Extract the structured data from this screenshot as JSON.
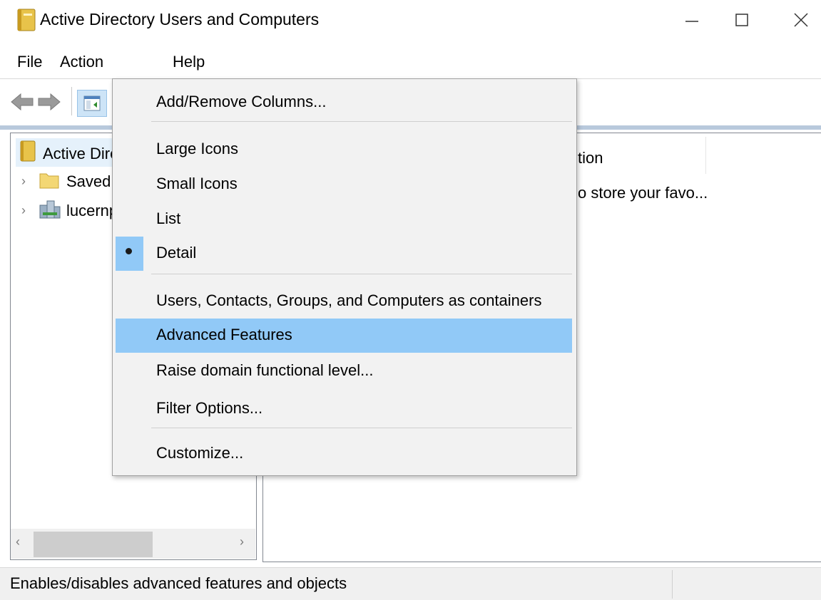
{
  "window": {
    "title": "Active Directory Users and Computers",
    "minimize_icon": "minimize-icon",
    "maximize_icon": "maximize-icon",
    "close_icon": "close-icon"
  },
  "menubar": {
    "file": "File",
    "action": "Action",
    "help": "Help"
  },
  "toolbar": {
    "icons": [
      "back-arrow-icon",
      "forward-arrow-icon",
      "show-hide-console-tree-icon"
    ]
  },
  "tree": {
    "root_label": "Active Dire",
    "items": [
      {
        "label": "Saved (",
        "icon": "folder-icon"
      },
      {
        "label": "lucernp",
        "icon": "domain-icon"
      }
    ]
  },
  "details": {
    "column_header_partial": "tion",
    "row_text_partial": "o store your favo..."
  },
  "view_menu": {
    "items": [
      {
        "label": "Add/Remove Columns..."
      },
      {
        "label": "Large Icons"
      },
      {
        "label": "Small Icons"
      },
      {
        "label": "List"
      },
      {
        "label": "Detail",
        "selected": true
      },
      {
        "label": "Users, Contacts, Groups, and Computers as containers"
      },
      {
        "label": "Advanced Features",
        "highlighted": true
      },
      {
        "label": "Raise domain functional level..."
      },
      {
        "label": "Filter Options..."
      },
      {
        "label": "Customize..."
      }
    ]
  },
  "statusbar": {
    "text": "Enables/disables advanced features and objects"
  },
  "colors": {
    "highlight": "#91c9f7",
    "menu_background": "#f2f2f2",
    "statusbar_background": "#f0f0f0"
  }
}
